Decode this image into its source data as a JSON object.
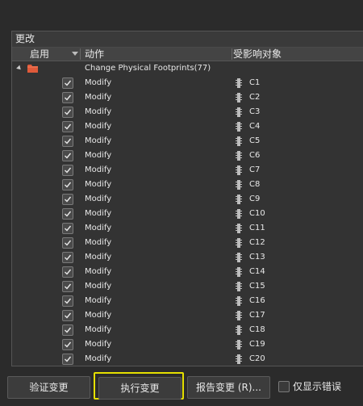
{
  "group_title": "更改",
  "columns": {
    "enable": "启用",
    "action": "动作",
    "target": "受影响对象"
  },
  "group_row": {
    "action": "Change Physical Footprints(77)"
  },
  "rows": [
    {
      "action": "Modify",
      "target": "C1"
    },
    {
      "action": "Modify",
      "target": "C2"
    },
    {
      "action": "Modify",
      "target": "C3"
    },
    {
      "action": "Modify",
      "target": "C4"
    },
    {
      "action": "Modify",
      "target": "C5"
    },
    {
      "action": "Modify",
      "target": "C6"
    },
    {
      "action": "Modify",
      "target": "C7"
    },
    {
      "action": "Modify",
      "target": "C8"
    },
    {
      "action": "Modify",
      "target": "C9"
    },
    {
      "action": "Modify",
      "target": "C10"
    },
    {
      "action": "Modify",
      "target": "C11"
    },
    {
      "action": "Modify",
      "target": "C12"
    },
    {
      "action": "Modify",
      "target": "C13"
    },
    {
      "action": "Modify",
      "target": "C14"
    },
    {
      "action": "Modify",
      "target": "C15"
    },
    {
      "action": "Modify",
      "target": "C16"
    },
    {
      "action": "Modify",
      "target": "C17"
    },
    {
      "action": "Modify",
      "target": "C18"
    },
    {
      "action": "Modify",
      "target": "C19"
    },
    {
      "action": "Modify",
      "target": "C20"
    }
  ],
  "buttons": {
    "validate": "验证变更",
    "execute": "执行变更",
    "report": "报告变更 (R)..."
  },
  "only_errors_label": "仅显示错误",
  "colors": {
    "highlight": "#e6e000",
    "folder": "#e05a3a",
    "background": "#2b2b2b"
  }
}
